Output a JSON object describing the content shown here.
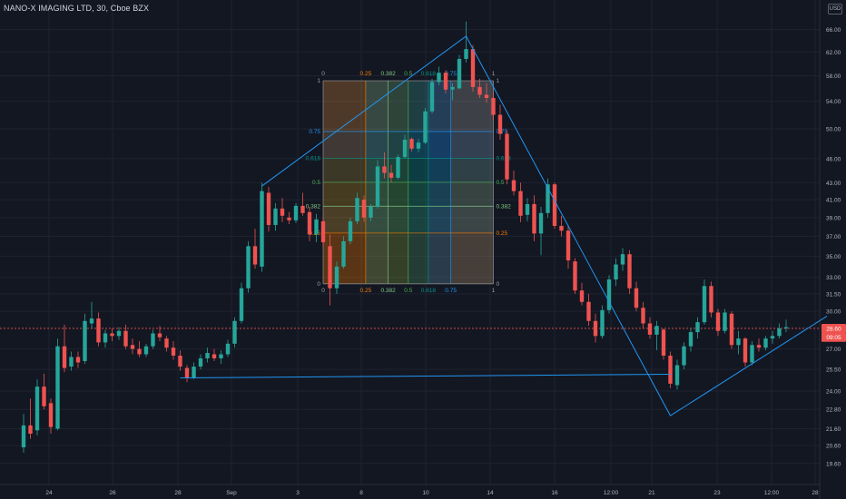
{
  "header": {
    "title": "NANO-X IMAGING LTD, 30, Cboe BZX",
    "currency_button": "USD"
  },
  "colors": {
    "background": "#131722",
    "grid": "#1f2330",
    "up": "#26a69a",
    "down": "#ef5350",
    "drawing": "#2196f3",
    "text": "#b2b5be"
  },
  "chart_data": {
    "type": "candlestick",
    "title": "NANO-X IMAGING LTD, 30, Cboe BZX",
    "y_scale": "log",
    "ylim": [
      19.0,
      68.5
    ],
    "y_ticks": [
      "66.00",
      "62.00",
      "58.00",
      "54.00",
      "50.00",
      "46.00",
      "43.00",
      "41.00",
      "39.00",
      "37.00",
      "35.00",
      "33.00",
      "31.50",
      "30.00",
      "27.00",
      "25.50",
      "24.00",
      "22.80",
      "21.60",
      "20.60",
      "19.60"
    ],
    "x_ticks": [
      "24",
      "26",
      "28",
      "Sep",
      "3",
      "8",
      "10",
      "14",
      "16",
      "12:00",
      "21",
      "23",
      "12:00",
      "28"
    ],
    "price_labels": [
      {
        "text": "28.60",
        "value": 28.6,
        "kind": "last"
      },
      {
        "text": "09:05",
        "value": 27.9,
        "kind": "countdown"
      }
    ],
    "candles": [
      [
        20.5,
        22.5,
        20.2,
        21.8
      ],
      [
        21.8,
        23.5,
        21.0,
        21.3
      ],
      [
        21.5,
        24.8,
        21.2,
        24.3
      ],
      [
        24.3,
        25.2,
        22.8,
        23.0
      ],
      [
        23.2,
        23.5,
        21.3,
        21.7
      ],
      [
        21.6,
        27.8,
        21.5,
        27.2
      ],
      [
        27.2,
        28.9,
        25.3,
        25.6
      ],
      [
        25.7,
        26.8,
        25.4,
        26.4
      ],
      [
        26.4,
        26.8,
        25.6,
        26.0
      ],
      [
        26.1,
        29.8,
        25.9,
        29.2
      ],
      [
        29.0,
        30.8,
        28.6,
        29.4
      ],
      [
        29.4,
        29.9,
        27.2,
        27.5
      ],
      [
        27.5,
        28.5,
        27.1,
        28.2
      ],
      [
        28.2,
        28.6,
        27.6,
        28.0
      ],
      [
        28.0,
        28.7,
        27.7,
        28.4
      ],
      [
        28.4,
        28.9,
        27.0,
        27.2
      ],
      [
        27.3,
        27.8,
        26.6,
        27.0
      ],
      [
        27.0,
        27.6,
        26.4,
        26.6
      ],
      [
        26.6,
        27.4,
        26.4,
        27.2
      ],
      [
        27.2,
        28.5,
        27.0,
        28.2
      ],
      [
        28.2,
        28.8,
        27.6,
        27.9
      ],
      [
        27.8,
        28.0,
        26.8,
        27.1
      ],
      [
        27.1,
        27.6,
        26.2,
        26.5
      ],
      [
        26.5,
        26.9,
        25.4,
        25.7
      ],
      [
        25.6,
        25.8,
        24.6,
        24.9
      ],
      [
        24.9,
        26.0,
        24.8,
        25.7
      ],
      [
        25.7,
        26.6,
        25.5,
        26.3
      ],
      [
        26.3,
        27.1,
        26.0,
        26.7
      ],
      [
        26.6,
        27.0,
        26.1,
        26.3
      ],
      [
        26.3,
        26.9,
        25.9,
        26.6
      ],
      [
        26.6,
        27.7,
        26.4,
        27.4
      ],
      [
        27.4,
        29.5,
        27.1,
        29.2
      ],
      [
        29.2,
        32.5,
        29.0,
        32.0
      ],
      [
        32.0,
        36.5,
        31.6,
        36.0
      ],
      [
        36.0,
        37.8,
        33.8,
        34.2
      ],
      [
        34.0,
        43.0,
        33.5,
        42.0
      ],
      [
        41.8,
        42.5,
        37.5,
        38.2
      ],
      [
        38.2,
        40.6,
        37.6,
        40.0
      ],
      [
        40.0,
        41.2,
        38.5,
        39.2
      ],
      [
        39.0,
        39.6,
        38.3,
        38.7
      ],
      [
        38.7,
        40.6,
        38.4,
        40.3
      ],
      [
        40.3,
        41.8,
        39.2,
        39.5
      ],
      [
        39.6,
        40.2,
        36.5,
        37.2
      ],
      [
        37.2,
        39.4,
        36.4,
        38.8
      ],
      [
        38.6,
        39.0,
        36.0,
        36.4
      ],
      [
        36.0,
        37.2,
        30.5,
        32.0
      ],
      [
        32.0,
        34.5,
        31.5,
        34.0
      ],
      [
        34.0,
        37.0,
        33.8,
        36.5
      ],
      [
        36.5,
        39.0,
        36.2,
        38.6
      ],
      [
        38.6,
        41.8,
        38.3,
        41.2
      ],
      [
        41.0,
        41.5,
        38.5,
        39.0
      ],
      [
        39.0,
        40.5,
        38.6,
        40.2
      ],
      [
        40.2,
        45.8,
        40.0,
        45.0
      ],
      [
        45.0,
        46.8,
        43.5,
        44.2
      ],
      [
        44.2,
        45.2,
        43.1,
        43.6
      ],
      [
        43.6,
        46.5,
        43.4,
        46.2
      ],
      [
        46.2,
        49.2,
        46.0,
        48.5
      ],
      [
        48.6,
        48.8,
        46.9,
        47.3
      ],
      [
        47.3,
        48.6,
        46.8,
        48.1
      ],
      [
        48.1,
        53.0,
        47.9,
        52.5
      ],
      [
        52.5,
        57.5,
        52.2,
        57.0
      ],
      [
        57.0,
        59.5,
        56.5,
        58.5
      ],
      [
        58.5,
        58.9,
        55.2,
        55.8
      ],
      [
        55.8,
        56.8,
        54.2,
        56.2
      ],
      [
        56.0,
        61.5,
        55.8,
        60.8
      ],
      [
        60.8,
        67.5,
        60.2,
        62.5
      ],
      [
        62.5,
        63.2,
        55.5,
        56.2
      ],
      [
        56.2,
        57.5,
        54.5,
        55.0
      ],
      [
        55.0,
        56.8,
        53.8,
        54.5
      ],
      [
        54.5,
        55.2,
        51.2,
        52.0
      ],
      [
        52.0,
        53.5,
        48.5,
        49.3
      ],
      [
        49.3,
        49.8,
        42.8,
        43.4
      ],
      [
        43.3,
        44.5,
        41.5,
        42.0
      ],
      [
        42.0,
        43.0,
        38.5,
        39.2
      ],
      [
        39.3,
        41.2,
        38.6,
        40.5
      ],
      [
        40.5,
        41.5,
        36.5,
        37.3
      ],
      [
        37.3,
        40.2,
        35.1,
        39.5
      ],
      [
        39.5,
        43.5,
        39.0,
        42.8
      ],
      [
        42.8,
        43.0,
        37.8,
        38.1
      ],
      [
        38.1,
        39.2,
        37.0,
        37.6
      ],
      [
        37.6,
        38.2,
        33.8,
        34.6
      ],
      [
        34.5,
        34.8,
        31.5,
        31.8
      ],
      [
        31.8,
        32.5,
        30.5,
        30.8
      ],
      [
        30.8,
        31.5,
        28.8,
        29.2
      ],
      [
        29.2,
        29.8,
        27.5,
        28.0
      ],
      [
        28.0,
        30.5,
        27.8,
        30.1
      ],
      [
        30.1,
        33.2,
        29.8,
        32.8
      ],
      [
        32.8,
        34.8,
        32.2,
        34.2
      ],
      [
        34.2,
        35.8,
        33.6,
        35.2
      ],
      [
        35.2,
        35.6,
        31.5,
        32.0
      ],
      [
        32.0,
        32.6,
        30.0,
        30.3
      ],
      [
        30.3,
        30.8,
        28.6,
        29.0
      ],
      [
        29.0,
        29.5,
        27.8,
        28.1
      ],
      [
        28.1,
        29.2,
        26.9,
        28.8
      ],
      [
        28.5,
        28.6,
        26.2,
        26.5
      ],
      [
        26.5,
        26.8,
        24.2,
        24.5
      ],
      [
        24.4,
        26.2,
        24.1,
        25.8
      ],
      [
        25.8,
        27.5,
        25.5,
        27.2
      ],
      [
        27.2,
        28.6,
        26.8,
        28.3
      ],
      [
        28.3,
        29.5,
        27.8,
        29.1
      ],
      [
        29.1,
        32.8,
        28.9,
        32.2
      ],
      [
        32.2,
        32.6,
        29.5,
        29.9
      ],
      [
        29.9,
        30.2,
        28.0,
        28.4
      ],
      [
        28.4,
        30.2,
        28.2,
        29.9
      ],
      [
        29.8,
        30.0,
        27.0,
        27.3
      ],
      [
        27.3,
        28.4,
        26.6,
        27.8
      ],
      [
        27.8,
        27.9,
        25.7,
        26.0
      ],
      [
        26.0,
        27.6,
        25.8,
        27.3
      ],
      [
        27.3,
        27.8,
        26.8,
        27.1
      ],
      [
        27.1,
        28.0,
        26.9,
        27.8
      ],
      [
        27.8,
        28.4,
        27.4,
        28.0
      ],
      [
        28.0,
        29.0,
        27.8,
        28.6
      ],
      [
        28.6,
        29.3,
        28.3,
        28.7
      ]
    ],
    "overlays": {
      "trend_line_points": [
        {
          "candle": 35,
          "price": 42.6
        },
        {
          "candle": 65,
          "price": 64.8
        },
        {
          "candle": 95,
          "price": 22.4
        },
        {
          "candle": 118,
          "price": 29.6
        }
      ],
      "horizontal_line": {
        "from_candle": 23,
        "to_candle": 95,
        "price": 24.9
      },
      "last_price_line": 28.6,
      "fib_box": {
        "from_candle": 44,
        "to_candle": 69,
        "bottom_price": 32.4,
        "top_price": 57.2,
        "levels": [
          0,
          0.25,
          0.382,
          0.5,
          0.618,
          0.75,
          1
        ],
        "level_labels": [
          "0",
          "0.25",
          "0.382",
          "0.5",
          "0.618",
          "0.75",
          "1"
        ],
        "level_colors": [
          "#9e9e9e",
          "#f57c00",
          "#81c784",
          "#4caf50",
          "#009688",
          "#2196f3",
          "#9e9e9e"
        ]
      }
    }
  }
}
